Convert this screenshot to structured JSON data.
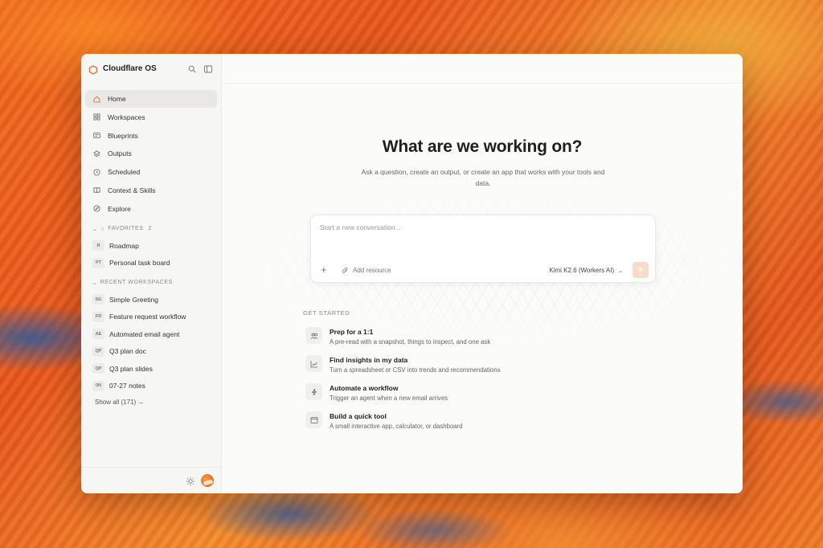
{
  "app": {
    "title": "Cloudflare OS",
    "accent": "#e8702a"
  },
  "sidebar": {
    "nav": [
      {
        "label": "Home",
        "icon": "home-icon",
        "active": true
      },
      {
        "label": "Workspaces",
        "icon": "grid-icon"
      },
      {
        "label": "Blueprints",
        "icon": "blueprint-icon"
      },
      {
        "label": "Outputs",
        "icon": "layers-icon"
      },
      {
        "label": "Scheduled",
        "icon": "clock-icon"
      },
      {
        "label": "Context & Skills",
        "icon": "book-icon"
      },
      {
        "label": "Explore",
        "icon": "compass-icon"
      }
    ],
    "favorites": {
      "label": "FAVORITES",
      "count": "2",
      "items": [
        {
          "badge": "R",
          "label": "Roadmap"
        },
        {
          "badge": "PT",
          "label": "Personal task board"
        }
      ]
    },
    "recent": {
      "label": "RECENT WORKSPACES",
      "items": [
        {
          "badge": "SG",
          "label": "Simple Greeting"
        },
        {
          "badge": "FR",
          "label": "Feature request workflow"
        },
        {
          "badge": "AE",
          "label": "Automated email agent"
        },
        {
          "badge": "QP",
          "label": "Q3 plan doc"
        },
        {
          "badge": "QP",
          "label": "Q3 plan slides"
        },
        {
          "badge": "0N",
          "label": "07-27 notes"
        }
      ],
      "show_all": "Show all (171) →"
    }
  },
  "main": {
    "title": "What are we working on?",
    "subtitle": "Ask a question, create an output, or create an app that works with your tools and data.",
    "composer": {
      "placeholder": "Start a new conversation...",
      "add_resource": "Add resource",
      "model": "Kimi K2.6 (Workers AI)"
    },
    "get_started": {
      "label": "GET STARTED",
      "items": [
        {
          "title": "Prep for a 1:1",
          "desc": "A pre-read with a snapshot, things to inspect, and one ask",
          "icon": "people-icon"
        },
        {
          "title": "Find insights in my data",
          "desc": "Turn a spreadsheet or CSV into trends and recommendations",
          "icon": "chart-icon"
        },
        {
          "title": "Automate a workflow",
          "desc": "Trigger an agent when a new email arrives",
          "icon": "lightning-icon"
        },
        {
          "title": "Build a quick tool",
          "desc": "A small interactive app, calculator, or dashboard",
          "icon": "window-icon"
        }
      ]
    }
  }
}
